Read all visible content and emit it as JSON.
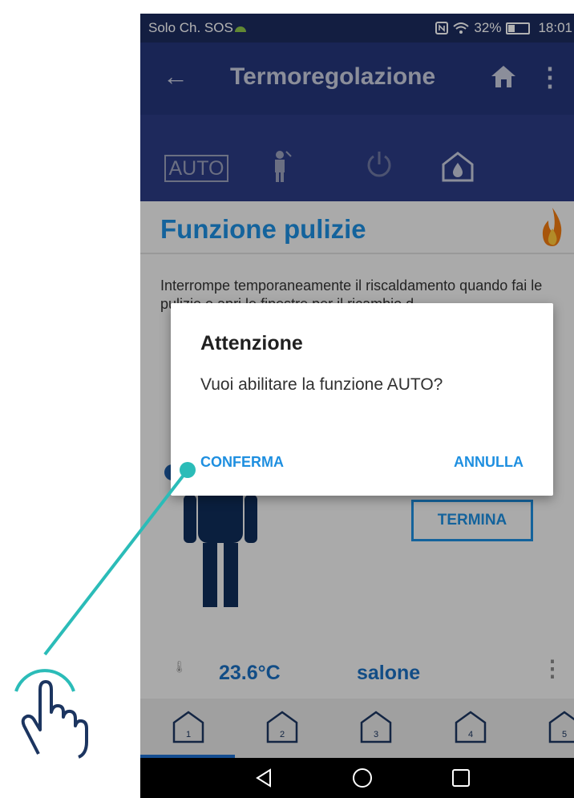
{
  "status_bar": {
    "carrier": "Solo Ch. SOS",
    "battery": "32%",
    "time": "18:01"
  },
  "app_bar": {
    "back_icon": "arrow-left-icon",
    "title": "Termoregolazione",
    "home_icon": "home-icon",
    "menu_icon": "more-vert-icon"
  },
  "modes": {
    "auto_label": "AUTO",
    "items": [
      "auto",
      "cleaning-icon",
      "power-icon",
      "antifreeze-icon"
    ]
  },
  "content": {
    "section_title": "Funzione pulizie",
    "flame_icon": "flame-icon",
    "description": "Interrompe temporaneamente il riscaldamento quando fai le pulizie e apri le finestre per il ricambio d",
    "termina_label": "TERMINA"
  },
  "room": {
    "temperature": "23.6°C",
    "name": "salone"
  },
  "tabs": {
    "items": [
      "1",
      "2",
      "3",
      "4",
      "5"
    ],
    "selected": "1"
  },
  "dialog": {
    "title": "Attenzione",
    "message": "Vuoi abilitare la funzione AUTO?",
    "confirm_label": "CONFERMA",
    "cancel_label": "ANNULLA"
  },
  "colors": {
    "accent": "#1e8fe0",
    "app_bar": "#24357a",
    "hint": "#2bbcb8",
    "hand": "#1c3560"
  }
}
